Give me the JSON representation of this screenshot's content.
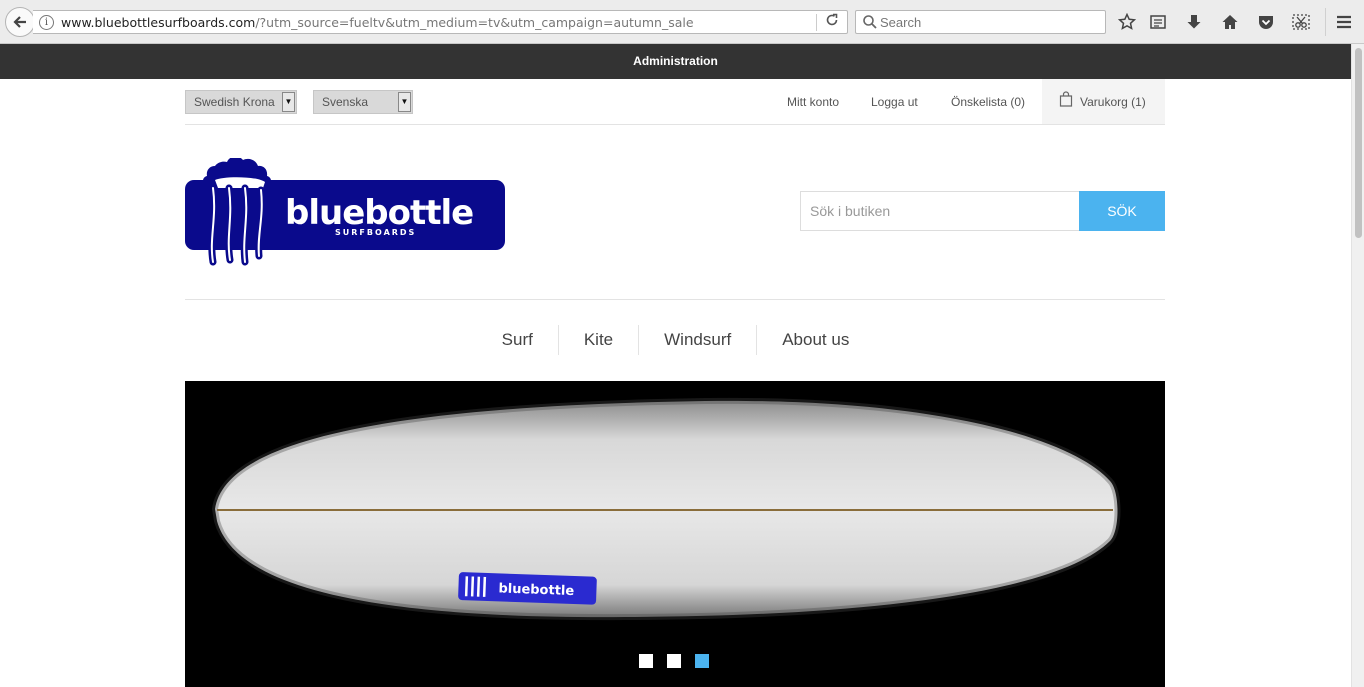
{
  "browser": {
    "url_host": "www.bluebottlesurfboards.com",
    "url_path": "/?utm_source=fueltv&utm_medium=tv&utm_campaign=autumn_sale",
    "search_placeholder": "Search"
  },
  "admin_bar": {
    "label": "Administration"
  },
  "top_nav": {
    "currency": "Swedish Krona",
    "language": "Svenska",
    "my_account": "Mitt konto",
    "logout": "Logga ut",
    "wishlist": "Önskelista (0)",
    "cart": "Varukorg (1)"
  },
  "logo": {
    "text": "bluebottle",
    "subtext": "SURFBOARDS",
    "brand_color": "#0a0a8c"
  },
  "store_search": {
    "placeholder": "Sök i butiken",
    "button": "SÖK"
  },
  "main_menu": [
    {
      "label": "Surf"
    },
    {
      "label": "Kite"
    },
    {
      "label": "Windsurf"
    },
    {
      "label": "About us"
    }
  ],
  "slider": {
    "slide_count": 3,
    "active_index": 2,
    "board_logo_text": "bluebottle",
    "accent_color": "#4bb3ef"
  }
}
